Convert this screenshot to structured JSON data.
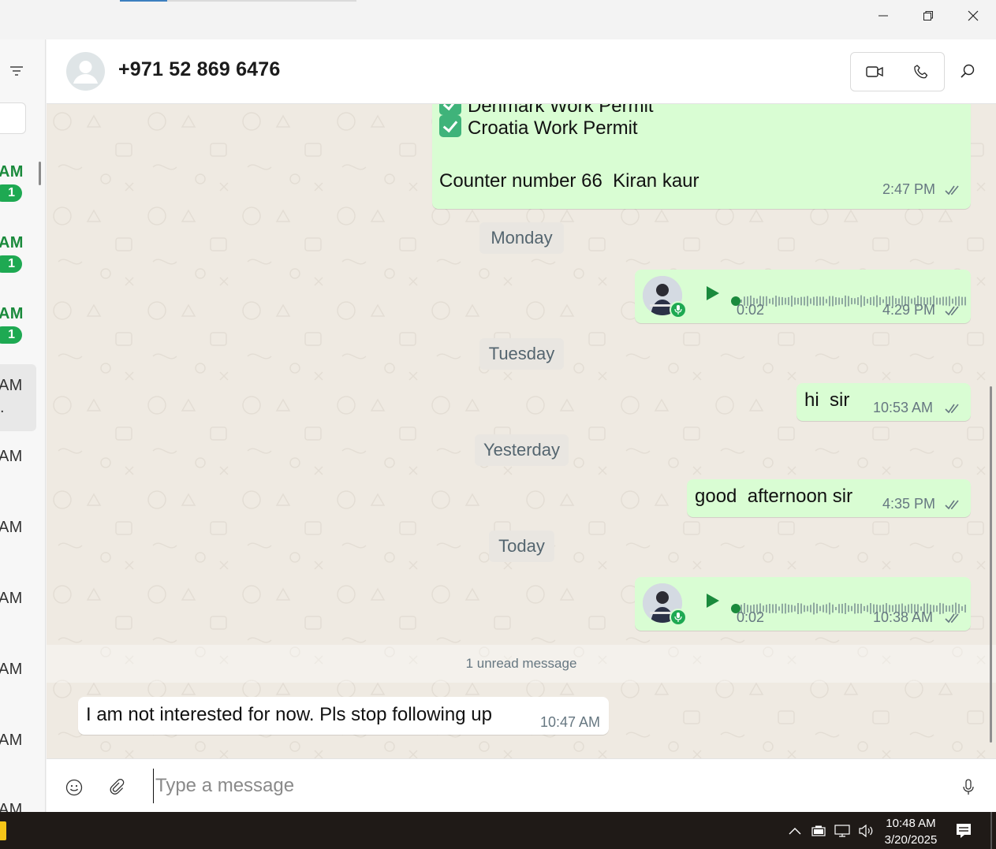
{
  "window": {
    "minimize_icon": "minimize-icon",
    "maximize_icon": "restore-icon",
    "close_icon": "close-icon"
  },
  "sidebar": {
    "filter_icon": "filter-icon",
    "items": [
      {
        "time": "AM",
        "unread": "1"
      },
      {
        "time": "AM",
        "unread": "1"
      },
      {
        "time": "AM",
        "unread": "1"
      },
      {
        "time": "AM",
        "preview": "."
      },
      {
        "time": "AM"
      },
      {
        "time": "AM"
      },
      {
        "time": "AM"
      },
      {
        "time": "AM"
      },
      {
        "time": "AM"
      },
      {
        "time": "AM"
      }
    ]
  },
  "header": {
    "contact_name": "+971 52 869 6476",
    "video_icon": "video-call-icon",
    "call_icon": "voice-call-icon",
    "search_icon": "search-icon"
  },
  "messages": {
    "m1_line1": "Denmark Work Permit",
    "m1_line2": "Croatia Work Permit",
    "m1_line3": "Counter number 66  Kiran kaur",
    "m1_time": "2:47 PM",
    "day1": "Monday",
    "vn1_duration": "0:02",
    "vn1_time": "4:29 PM",
    "day2": "Tuesday",
    "m2_text": "hi  sir",
    "m2_time": "10:53 AM",
    "day3": "Yesterday",
    "m3_text": "good  afternoon sir",
    "m3_time": "4:35 PM",
    "day4": "Today",
    "vn2_duration": "0:02",
    "vn2_time": "10:38 AM",
    "unread_divider": "1 unread message",
    "m4_text": "I am not interested for now. Pls stop following up",
    "m4_time": "10:47 AM"
  },
  "composer": {
    "placeholder": "Type a message",
    "emoji_icon": "emoji-icon",
    "attach_icon": "paperclip-icon",
    "mic_icon": "microphone-icon"
  },
  "taskbar": {
    "time": "10:48 AM",
    "date": "3/20/2025",
    "tray_icons": [
      "chevron-up-icon",
      "battery-icon",
      "network-icon",
      "volume-icon"
    ],
    "notification_icon": "notification-icon"
  },
  "colors": {
    "outgoing_bubble": "#d9fdd3",
    "incoming_bubble": "#ffffff",
    "chat_background": "#efeae2",
    "accent_green": "#1ea952",
    "read_ticks": "#667781"
  }
}
